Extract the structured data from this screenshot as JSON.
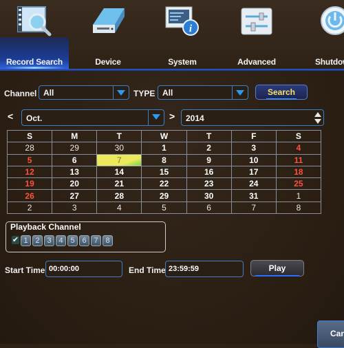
{
  "tabs": [
    {
      "label": "Record Search",
      "icon": "record-search-icon",
      "active": true
    },
    {
      "label": "Device",
      "icon": "hard-drive-icon",
      "active": false
    },
    {
      "label": "System",
      "icon": "system-info-icon",
      "active": false
    },
    {
      "label": "Advanced",
      "icon": "sliders-icon",
      "active": false
    },
    {
      "label": "Shutdown",
      "icon": "power-icon",
      "active": false
    }
  ],
  "filters": {
    "channel_label": "Channel",
    "channel_value": "All",
    "type_label": "TYPE",
    "type_value": "All",
    "search_label": "Search"
  },
  "date_nav": {
    "prev_glyph": "<",
    "next_glyph": ">",
    "month_value": "Oct.",
    "year_value": "2014"
  },
  "calendar": {
    "headers": [
      "S",
      "M",
      "T",
      "W",
      "T",
      "F",
      "S"
    ],
    "weeks": [
      [
        "28",
        "29",
        "30",
        "1",
        "2",
        "3",
        "4"
      ],
      [
        "5",
        "6",
        "7",
        "8",
        "9",
        "10",
        "11"
      ],
      [
        "12",
        "13",
        "14",
        "15",
        "16",
        "17",
        "18"
      ],
      [
        "19",
        "20",
        "21",
        "22",
        "23",
        "24",
        "25"
      ],
      [
        "26",
        "27",
        "28",
        "29",
        "30",
        "31",
        "1"
      ],
      [
        "2",
        "3",
        "4",
        "5",
        "6",
        "7",
        "8"
      ]
    ],
    "selected_day": "7",
    "weekend_color": "#ff5040",
    "today_color": "#ecea5c"
  },
  "playback": {
    "title": "Playback Channel",
    "all_checked": true,
    "check_glyph": "✔",
    "channels": [
      "1",
      "2",
      "3",
      "4",
      "5",
      "6",
      "7",
      "8"
    ]
  },
  "time": {
    "start_label": "Start Time",
    "start_value": "00:00:00",
    "end_label": "End Time",
    "end_value": "23:59:59",
    "play_label": "Play"
  },
  "cancel_label": "Can",
  "colors": {
    "accent": "#3d7fc8",
    "tab_active": "#1c3d96",
    "search_text": "#f3e36a"
  }
}
